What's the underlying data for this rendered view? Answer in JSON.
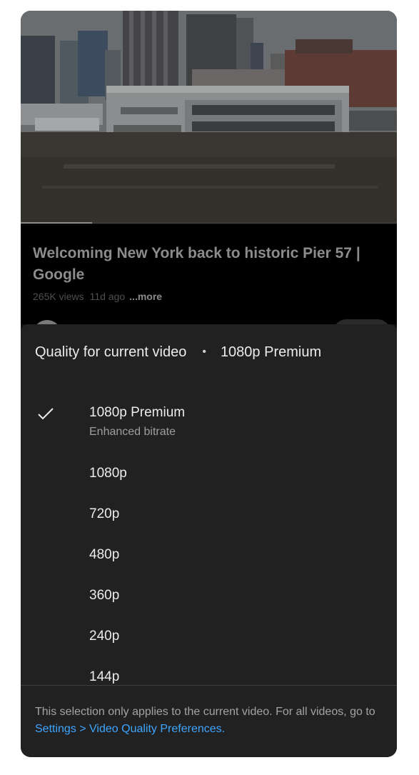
{
  "video": {
    "title": "Welcoming New York back to historic Pier 57 | Google",
    "views": "265K views",
    "age": "11d ago",
    "more_label": "...more",
    "progress": 0.19
  },
  "quality_sheet": {
    "header_label": "Quality for current video",
    "separator": "•",
    "current_quality": "1080p Premium",
    "options": [
      {
        "label": "1080p Premium",
        "sublabel": "Enhanced bitrate",
        "selected": true
      },
      {
        "label": "1080p",
        "selected": false
      },
      {
        "label": "720p",
        "selected": false
      },
      {
        "label": "480p",
        "selected": false
      },
      {
        "label": "360p",
        "selected": false
      },
      {
        "label": "240p",
        "selected": false
      },
      {
        "label": "144p",
        "selected": false
      }
    ],
    "footer_text": "This selection only applies to the current video. For all videos, go to",
    "footer_link": "Settings > Video Quality Preferences."
  },
  "colors": {
    "sheet_background": "#212121",
    "link": "#3ea6ff",
    "text_primary": "#ececec",
    "text_secondary": "#9e9e9e"
  },
  "icons": {
    "selected_marker": "check-icon"
  }
}
